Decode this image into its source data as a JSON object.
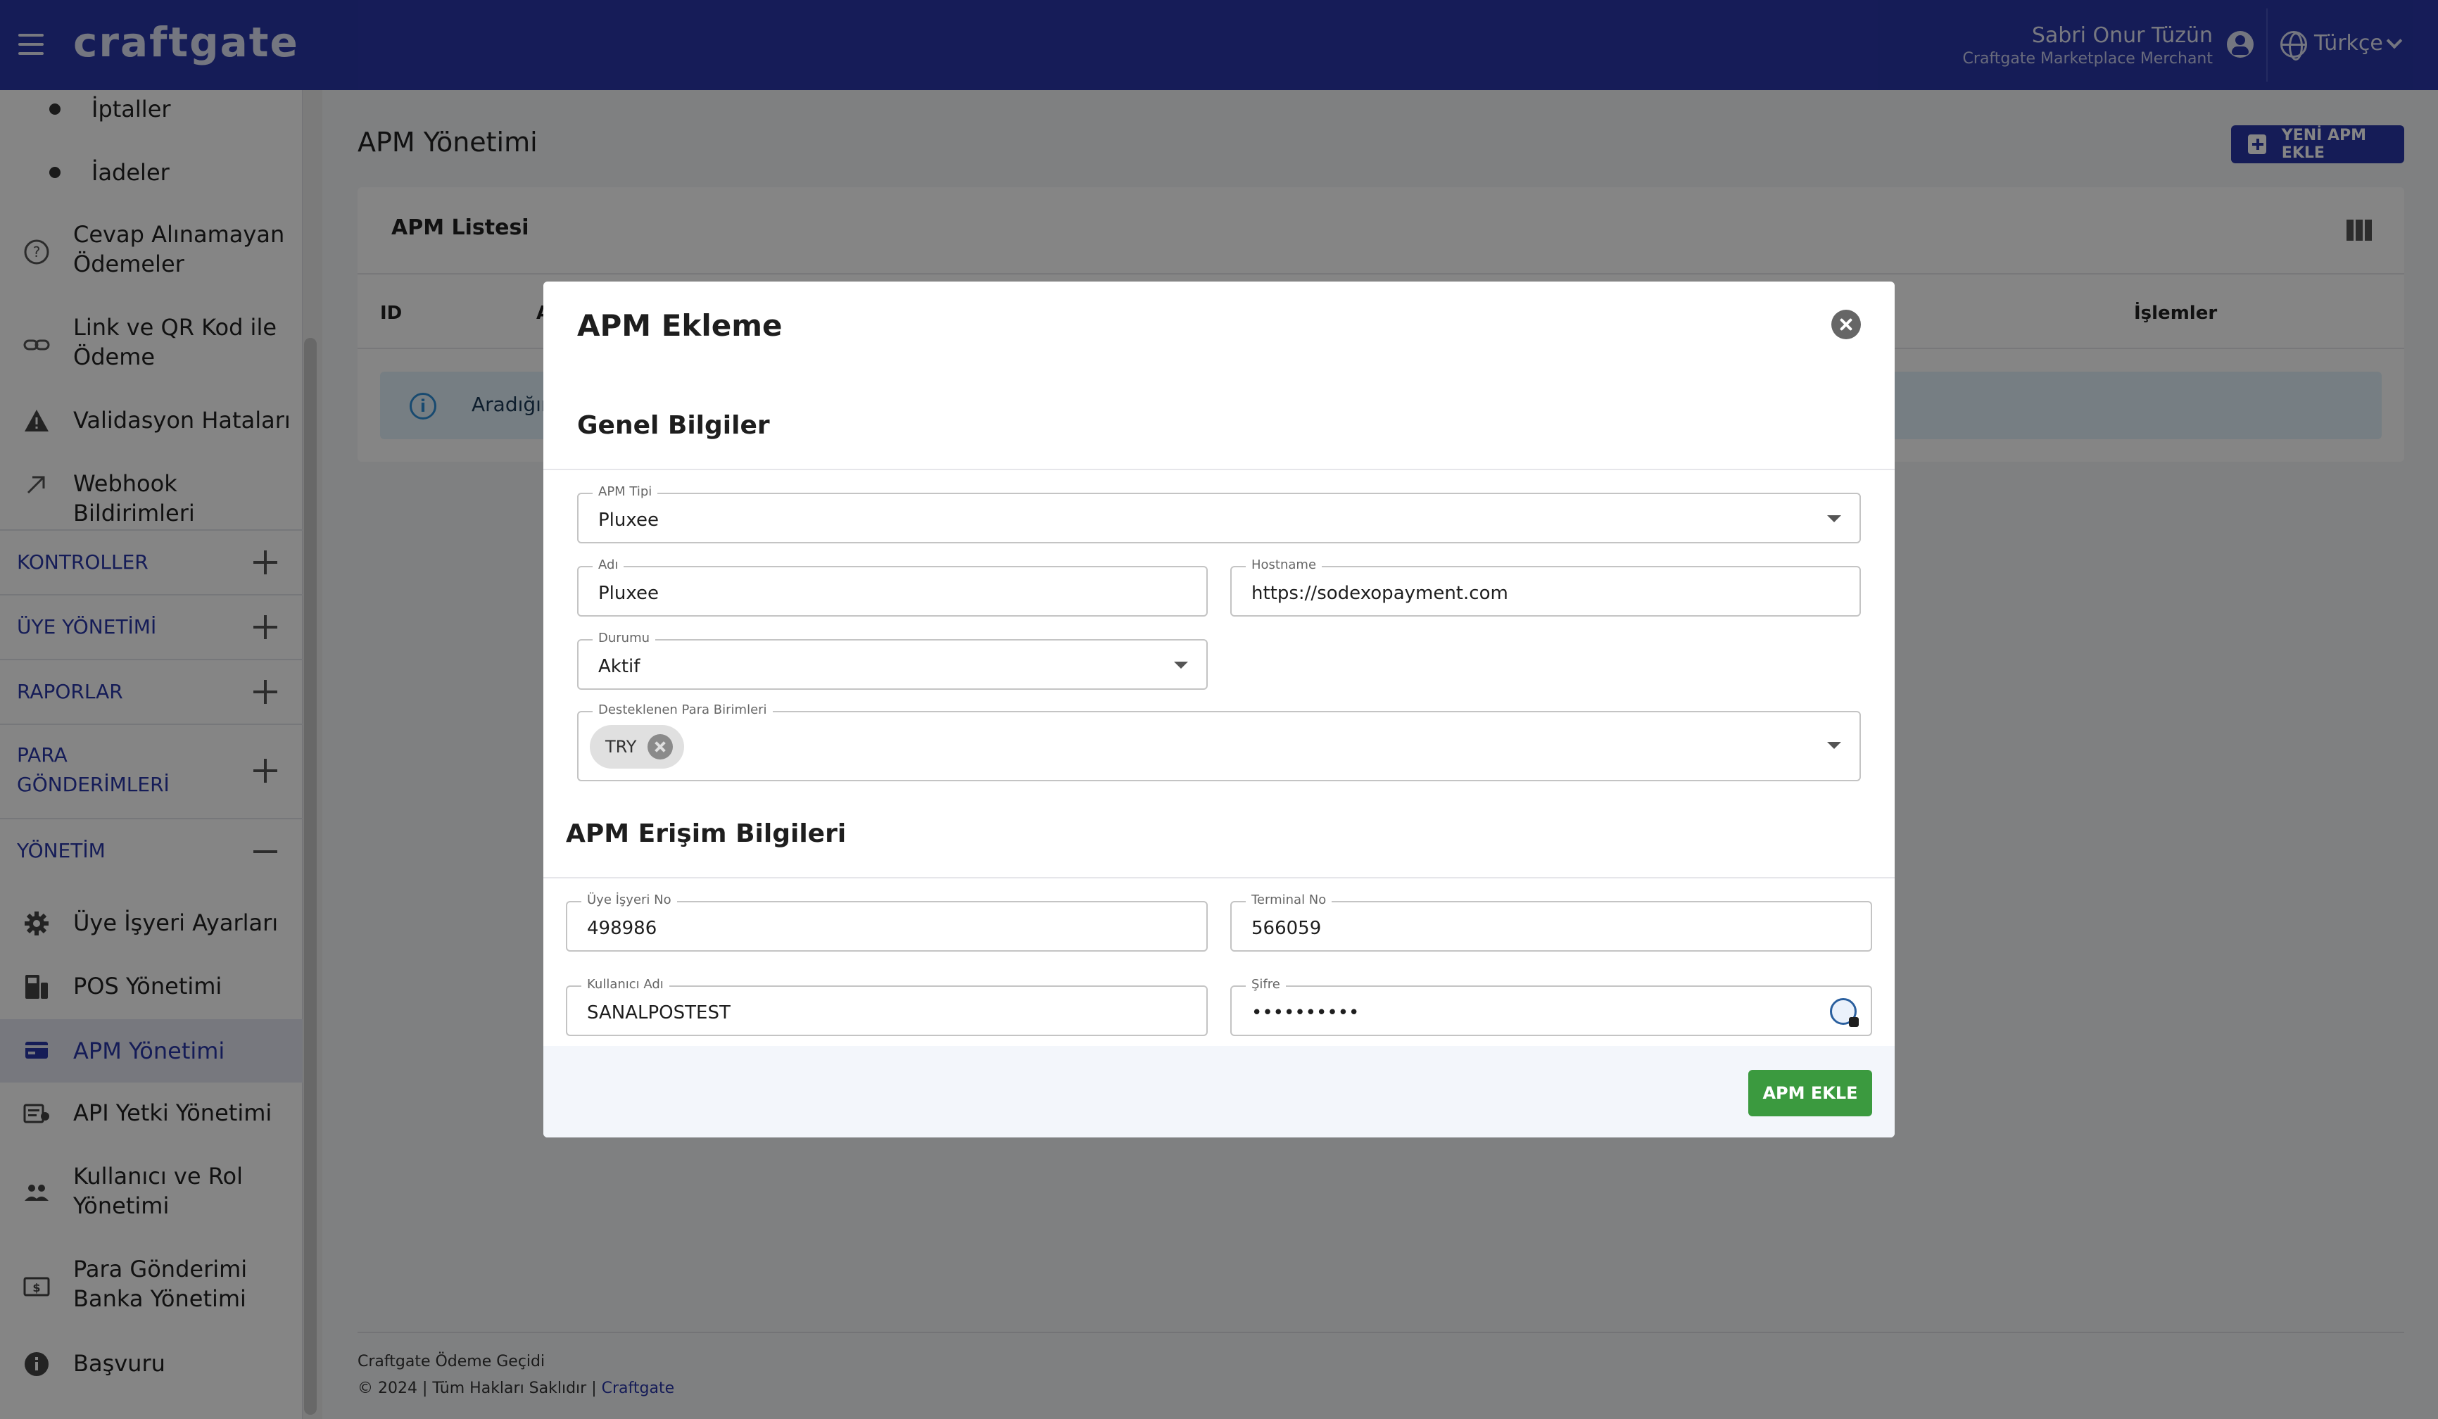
{
  "header": {
    "logo": "craftgate",
    "user_name": "Sabri Onur Tüzün",
    "user_role": "Craftgate Marketplace Merchant",
    "language": "Türkçe"
  },
  "sidebar": {
    "sub_items": [
      {
        "label": "İptaller"
      },
      {
        "label": "İadeler"
      }
    ],
    "top_items": [
      {
        "label": "Cevap Alınamayan Ödemeler",
        "icon": "question-circle-icon"
      },
      {
        "label": "Link ve QR Kod ile Ödeme",
        "icon": "link-icon"
      },
      {
        "label": "Validasyon Hataları",
        "icon": "warning-icon"
      },
      {
        "label": "Webhook Bildirimleri",
        "icon": "arrow-up-right-icon"
      }
    ],
    "groups": [
      {
        "label": "KONTROLLER"
      },
      {
        "label": "ÜYE YÖNETİMİ"
      },
      {
        "label": "RAPORLAR"
      },
      {
        "label": "PARA GÖNDERİMLERİ"
      },
      {
        "label": "YÖNETİM"
      }
    ],
    "admin_items": [
      {
        "label": "Üye İşyeri Ayarları",
        "icon": "gear-icon"
      },
      {
        "label": "POS Yönetimi",
        "icon": "pos-terminal-icon"
      },
      {
        "label": "APM Yönetimi",
        "icon": "apm-icon",
        "active": true
      },
      {
        "label": "API Yetki Yönetimi",
        "icon": "api-key-icon"
      },
      {
        "label": "Kullanıcı ve Rol Yönetimi",
        "icon": "users-icon"
      },
      {
        "label": "Para Gönderimi Banka Yönetimi",
        "icon": "bank-icon"
      },
      {
        "label": "Başvuru",
        "icon": "info-icon"
      }
    ]
  },
  "main": {
    "page_title": "APM Yönetimi",
    "new_button": "YENİ APM EKLE",
    "card_title": "APM Listesi",
    "columns": {
      "id": "ID",
      "second": "A",
      "actions": "İşlemler"
    },
    "info_text": "Aradığınız"
  },
  "footer": {
    "line1": "Craftgate Ödeme Geçidi",
    "line2": "© 2024 | Tüm Hakları Saklıdır |",
    "link": "Craftgate"
  },
  "modal": {
    "title": "APM Ekleme",
    "section_general": "Genel Bilgiler",
    "section_access": "APM Erişim Bilgileri",
    "fields": {
      "apm_type": {
        "label": "APM Tipi",
        "value": "Pluxee"
      },
      "name": {
        "label": "Adı",
        "value": "Pluxee"
      },
      "hostname": {
        "label": "Hostname",
        "value": "https://sodexopayment.com"
      },
      "status": {
        "label": "Durumu",
        "value": "Aktif"
      },
      "currencies": {
        "label": "Desteklenen Para Birimleri",
        "chips": [
          "TRY"
        ]
      },
      "merchant_no": {
        "label": "Üye İşyeri No",
        "value": "498986"
      },
      "terminal_no": {
        "label": "Terminal No",
        "value": "566059"
      },
      "username": {
        "label": "Kullanıcı Adı",
        "value": "SANALPOSTEST"
      },
      "password": {
        "label": "Şifre",
        "value": "••••••••••"
      }
    },
    "submit": "APM EKLE"
  },
  "colors": {
    "brand": "#2a36a8",
    "submit": "#3b9a3f",
    "info_bg": "#e3f2fb"
  }
}
